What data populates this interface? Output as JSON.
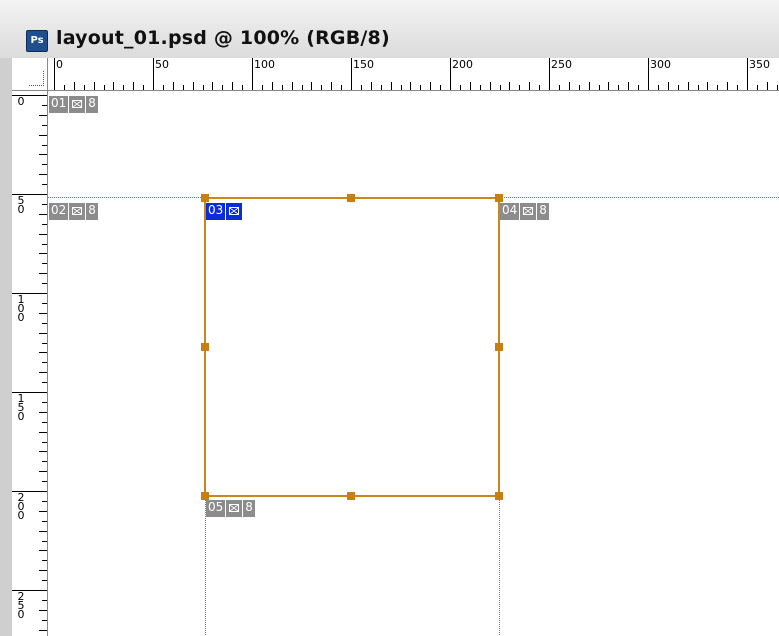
{
  "window": {
    "icon_label": "Ps",
    "title": "layout_01.psd @ 100% (RGB/8)"
  },
  "ruler_h": {
    "labels": [
      "0",
      "50",
      "100",
      "150",
      "200",
      "250",
      "300",
      "350"
    ]
  },
  "ruler_v": {
    "labels": [
      "0",
      "5\n0",
      "1\n0\n0",
      "1\n5\n0",
      "2\n0\n0",
      "2\n5\n0"
    ]
  },
  "slices": [
    {
      "id": "01",
      "type": "image",
      "flag": "8",
      "active": false
    },
    {
      "id": "02",
      "type": "image",
      "flag": "8",
      "active": false
    },
    {
      "id": "03",
      "type": "image",
      "flag": "",
      "active": true
    },
    {
      "id": "04",
      "type": "image",
      "flag": "8",
      "active": false
    },
    {
      "id": "05",
      "type": "image",
      "flag": "8",
      "active": false
    }
  ],
  "colors": {
    "guide": "#3a8de0",
    "selection": "#c8861b",
    "slice_active": "#0a2cd9",
    "slice_inactive": "#8c8c8c"
  }
}
